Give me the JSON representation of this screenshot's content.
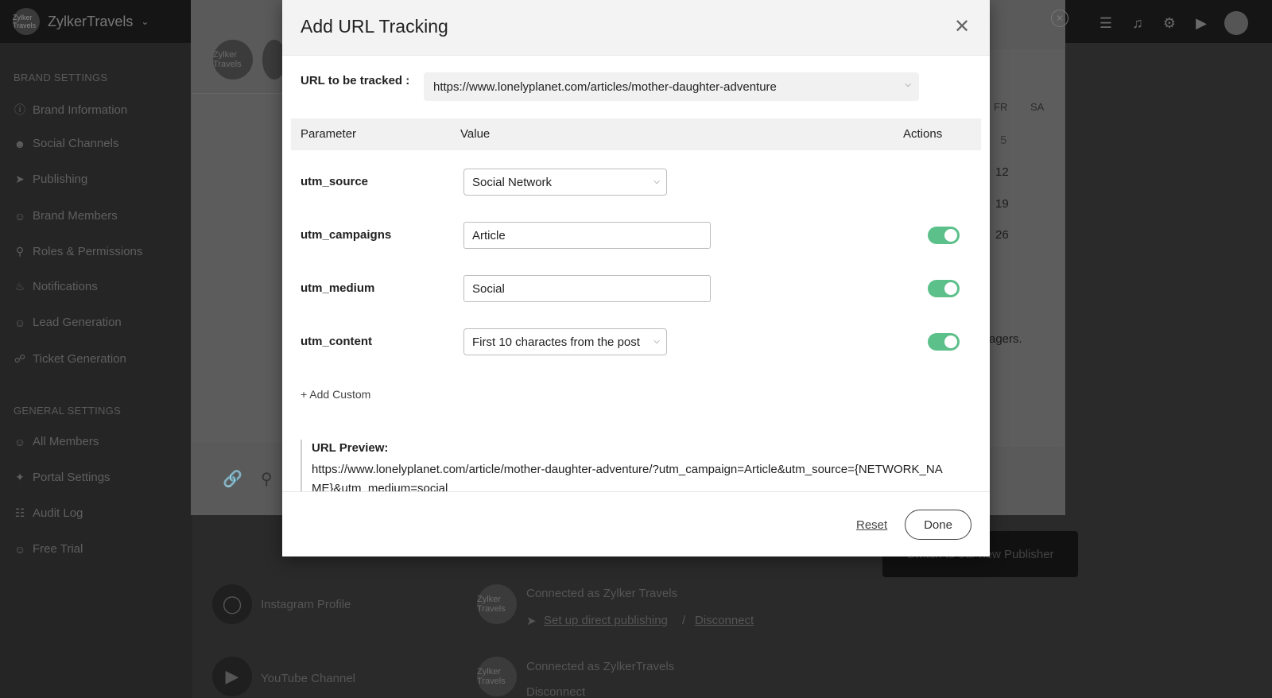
{
  "app": {
    "brand_name": "ZylkerTravels",
    "logo_text": "Zylker Travels"
  },
  "sidebar": {
    "brand_section": "BRAND SETTINGS",
    "brand_items": [
      {
        "label": "Brand Information",
        "icon": "info-icon"
      },
      {
        "label": "Social Channels",
        "icon": "people-icon"
      },
      {
        "label": "Publishing",
        "icon": "send-icon"
      },
      {
        "label": "Brand Members",
        "icon": "members-icon"
      },
      {
        "label": "Roles & Permissions",
        "icon": "key-icon"
      },
      {
        "label": "Notifications",
        "icon": "bell-icon"
      },
      {
        "label": "Lead Generation",
        "icon": "lead-icon"
      },
      {
        "label": "Ticket Generation",
        "icon": "ticket-icon"
      }
    ],
    "general_section": "GENERAL SETTINGS",
    "general_items": [
      {
        "label": "All Members",
        "icon": "members-icon"
      },
      {
        "label": "Portal Settings",
        "icon": "tools-icon"
      },
      {
        "label": "Audit Log",
        "icon": "log-icon"
      },
      {
        "label": "Free Trial",
        "icon": "trial-icon"
      }
    ]
  },
  "background": {
    "calendar_headers": [
      "FR",
      "SA"
    ],
    "calendar_days": [
      "5",
      "12",
      "19",
      "26"
    ],
    "managers_fragment": "agers.",
    "instagram_label": "Instagram Profile",
    "youtube_label": "YouTube Channel",
    "connected_instagram": "Connected as Zylker Travels",
    "connected_youtube": "Connected as ZylkerTravels",
    "set_up_publishing": "Set up direct publishing",
    "separator": "/",
    "disconnect": "Disconnect",
    "publisher_button": "Switch to our new Publisher"
  },
  "modal": {
    "title": "Add URL Tracking",
    "url_label": "URL to be tracked :",
    "url_value": "https://www.lonelyplanet.com/articles/mother-daughter-adventure",
    "table_headers": {
      "parameter": "Parameter",
      "value": "Value",
      "actions": "Actions"
    },
    "params": [
      {
        "name": "utm_source",
        "value": "Social Network",
        "type": "select",
        "toggle": null
      },
      {
        "name": "utm_campaigns",
        "value": "Article",
        "type": "text",
        "toggle": true
      },
      {
        "name": "utm_medium",
        "value": "Social",
        "type": "text",
        "toggle": true
      },
      {
        "name": "utm_content",
        "value": "First 10 charactes from the post",
        "type": "select",
        "toggle": true
      }
    ],
    "add_custom": "+ Add Custom",
    "preview_label": "URL Preview:",
    "preview_url": "https://www.lonelyplanet.com/article/mother-daughter-adventure/?utm_campaign=Article&utm_source={NETWORK_NAME}&utm_medium=social",
    "reset_label": "Reset",
    "done_label": "Done"
  },
  "colors": {
    "toggle_on": "#5cc08a",
    "overlay": "#2b2b2b"
  }
}
